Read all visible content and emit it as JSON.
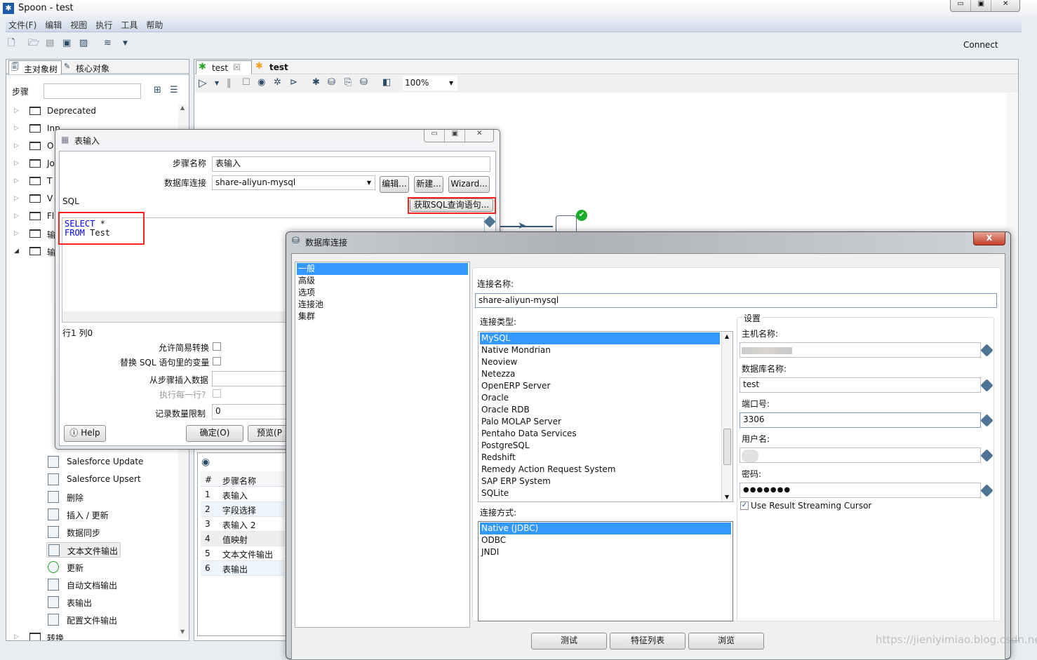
{
  "window": {
    "title": "Spoon - test",
    "connect": "Connect"
  },
  "menu": [
    "文件(F)",
    "编辑",
    "视图",
    "执行",
    "工具",
    "帮助"
  ],
  "left_panel": {
    "tabs": [
      "主对象树",
      "核心对象"
    ],
    "search_label": "步骤",
    "search_value": "",
    "folders": [
      "Deprecated",
      "Inp",
      "O",
      "Jo",
      "T",
      "V",
      "Fl",
      "输",
      "输"
    ],
    "steps": [
      "Salesforce Update",
      "Salesforce Upsert",
      "删除",
      "插入 / 更新",
      "数据同步",
      "文本文件输出",
      "更新",
      "自动文档输出",
      "表输出",
      "配置文件输出"
    ],
    "bottom_folder": "转换",
    "selected_step": "文本文件输出"
  },
  "editor": {
    "tabs": [
      "test",
      "test"
    ],
    "zoom": "100%"
  },
  "steps_table": {
    "headers": [
      "#",
      "步骤名称"
    ],
    "rows": [
      [
        "1",
        "表输入"
      ],
      [
        "2",
        "字段选择"
      ],
      [
        "3",
        "表输入 2"
      ],
      [
        "4",
        "值映射"
      ],
      [
        "5",
        "文本文件输出"
      ],
      [
        "6",
        "表输出"
      ]
    ]
  },
  "table_input": {
    "title": "表输入",
    "step_name_label": "步骤名称",
    "step_name": "表输入",
    "db_label": "数据库连接",
    "db_value": "share-aliyun-mysql",
    "edit_btn": "编辑...",
    "new_btn": "新建...",
    "wizard_btn": "Wizard...",
    "sql_label": "SQL",
    "get_sql_btn": "获取SQL查询语句...",
    "sql_kw1": "SELECT",
    "sql_rest1": " *",
    "sql_kw2": "FROM",
    "sql_rest2": " Test",
    "position": "行1 列0",
    "lazy_label": "允许简易转换",
    "lazy_checked": false,
    "replace_label": "替换 SQL 语句里的变量",
    "replace_checked": false,
    "insert_label": "从步骤插入数据",
    "insert_value": "",
    "each_row_label": "执行每一行?",
    "each_row_checked": false,
    "limit_label": "记录数量限制",
    "limit_value": "0",
    "help_btn": "Help",
    "ok_btn": "确定(O)",
    "preview_btn": "预览(P"
  },
  "db_dialog": {
    "title": "数据库连接",
    "nav": [
      "一般",
      "高级",
      "选项",
      "连接池",
      "集群"
    ],
    "nav_selected": "一般",
    "conn_name_label": "连接名称:",
    "conn_name": "share-aliyun-mysql",
    "conn_type_label": "连接类型:",
    "conn_types": [
      "MySQL",
      "Native Mondrian",
      "Neoview",
      "Netezza",
      "OpenERP Server",
      "Oracle",
      "Oracle RDB",
      "Palo MOLAP Server",
      "Pentaho Data Services",
      "PostgreSQL",
      "Redshift",
      "Remedy Action Request System",
      "SAP ERP System",
      "SQLite"
    ],
    "conn_type_selected": "MySQL",
    "access_label": "连接方式:",
    "access": [
      "Native (JDBC)",
      "ODBC",
      "JNDI"
    ],
    "access_selected": "Native (JDBC)",
    "settings_label": "设置",
    "host_label": "主机名称:",
    "host": "",
    "dbname_label": "数据库名称:",
    "dbname": "test",
    "port_label": "端口号:",
    "port": "3306",
    "user_label": "用户名:",
    "user": "",
    "password_label": "密码:",
    "password": "●●●●●●●",
    "streaming_label": "Use Result Streaming Cursor",
    "streaming_checked": true,
    "test_btn": "测试",
    "features_btn": "特征列表",
    "explore_btn": "浏览"
  },
  "watermark": "https://jieniyimiao.blog.csdn.net",
  "colors": {
    "selection": "#3399ff",
    "highlight_box": "#ff2020",
    "sql_keyword": "#0000ff"
  }
}
